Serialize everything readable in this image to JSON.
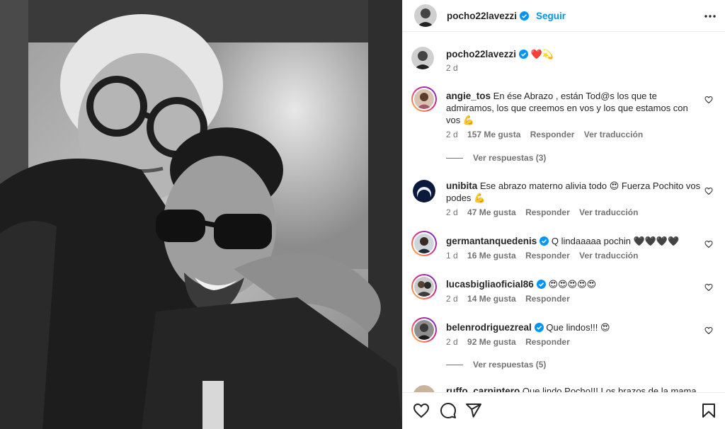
{
  "post": {
    "username": "pocho22lavezzi",
    "follow_label": "Seguir",
    "caption_emojis": "❤️💫",
    "caption_time": "2 d"
  },
  "comments": [
    {
      "username": "angie_tos",
      "verified": false,
      "text": "En ése Abrazo , están Tod@s los que te admiramos, los que creemos en vos y los que estamos con vos 💪",
      "time": "2 d",
      "likes": "157 Me gusta",
      "reply": "Responder",
      "translate": "Ver traducción",
      "view_replies": "Ver respuestas (3)"
    },
    {
      "username": "unibita",
      "verified": false,
      "text": "Ese abrazo materno alivia todo 😍 Fuerza Pochito vos podes 💪",
      "time": "2 d",
      "likes": "47 Me gusta",
      "reply": "Responder",
      "translate": "Ver traducción"
    },
    {
      "username": "germantanquedenis",
      "verified": true,
      "text": "Q lindaaaaa pochin 🖤🖤🖤🖤",
      "time": "1 d",
      "likes": "16 Me gusta",
      "reply": "Responder",
      "translate": "Ver traducción"
    },
    {
      "username": "lucasbigliaoficial86",
      "verified": true,
      "text": "😍😍😍😍😍",
      "time": "2 d",
      "likes": "14 Me gusta",
      "reply": "Responder"
    },
    {
      "username": "belenrodriguezreal",
      "verified": true,
      "text": "Que lindos!!! 😍",
      "time": "2 d",
      "likes": "92 Me gusta",
      "reply": "Responder",
      "view_replies": "Ver respuestas (5)"
    },
    {
      "username": "ruffo_carpintero",
      "verified": false,
      "text": "Que lindo Pocho!!! Los brazos de la mama"
    }
  ],
  "icons": {
    "more": "more-horizontal-icon",
    "like": "heart-outline-icon",
    "comment": "comment-bubble-icon",
    "share": "paper-plane-icon",
    "save": "bookmark-icon",
    "verified": "verified-badge-icon"
  },
  "colors": {
    "link": "#0095f6",
    "verified": "#0095f6",
    "meta": "#737373",
    "text": "#262626"
  }
}
